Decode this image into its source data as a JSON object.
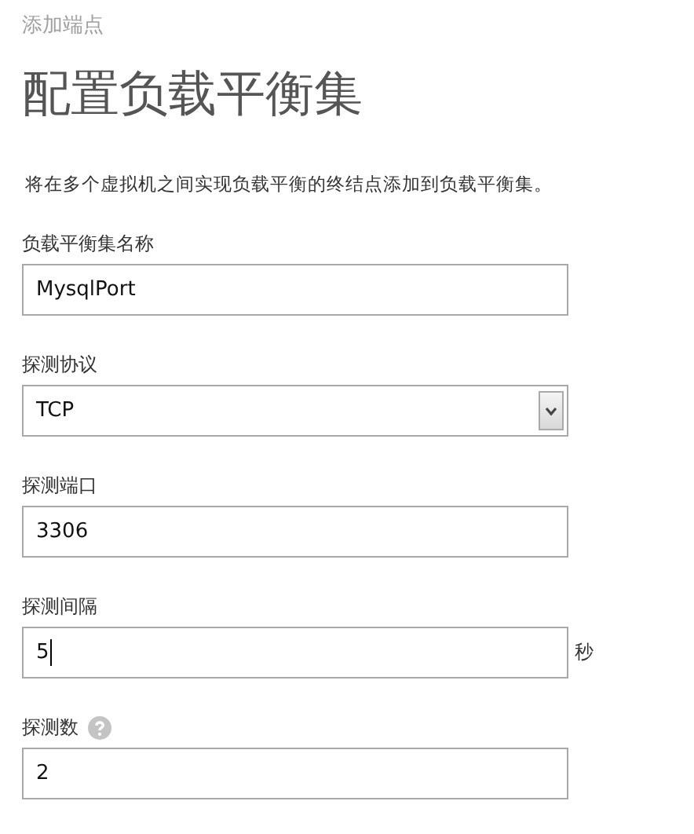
{
  "breadcrumb": "添加端点",
  "title": "配置负载平衡集",
  "description": "将在多个虚拟机之间实现负载平衡的终结点添加到负载平衡集。",
  "fields": [
    {
      "kind": "text",
      "label": "负载平衡集名称",
      "value": "MysqlPort",
      "focused": false,
      "help": false
    },
    {
      "kind": "select",
      "label": "探测协议",
      "value": "TCP",
      "focused": false,
      "help": false
    },
    {
      "kind": "text",
      "label": "探测端口",
      "value": "3306",
      "focused": false,
      "help": false
    },
    {
      "kind": "text",
      "label": "探测间隔",
      "value": "5",
      "focused": true,
      "help": false,
      "suffix": "秒"
    },
    {
      "kind": "text",
      "label": "探测数",
      "value": "2",
      "focused": false,
      "help": true
    }
  ]
}
